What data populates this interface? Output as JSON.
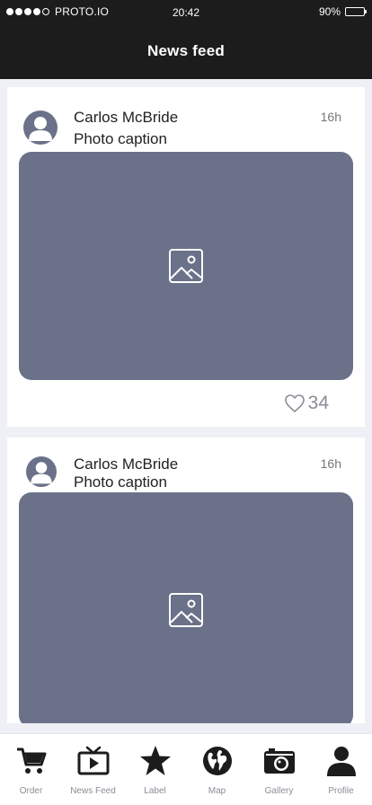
{
  "status_bar": {
    "carrier": "PROTO.IO",
    "signal_dots": 5,
    "signal_filled": 4,
    "time": "20:42",
    "battery_text": "90%",
    "battery_level": 0.9
  },
  "header": {
    "title": "News feed"
  },
  "posts": [
    {
      "author": "Carlos McBride",
      "caption": "Photo caption",
      "time": "16h",
      "likes": "34"
    },
    {
      "author": "Carlos McBride",
      "caption": "Photo caption",
      "time": "16h"
    }
  ],
  "tabs": [
    {
      "label": "Order",
      "icon": "cart-icon"
    },
    {
      "label": "News Feed",
      "icon": "tv-play-icon"
    },
    {
      "label": "Label",
      "icon": "star-icon"
    },
    {
      "label": "Map",
      "icon": "globe-icon"
    },
    {
      "label": "Gallery",
      "icon": "camera-icon"
    },
    {
      "label": "Profile",
      "icon": "person-icon"
    }
  ],
  "colors": {
    "bar": "#1c1c1c",
    "placeholder": "#6b7188",
    "background": "#eef0f6",
    "muted": "#8a8d96"
  }
}
